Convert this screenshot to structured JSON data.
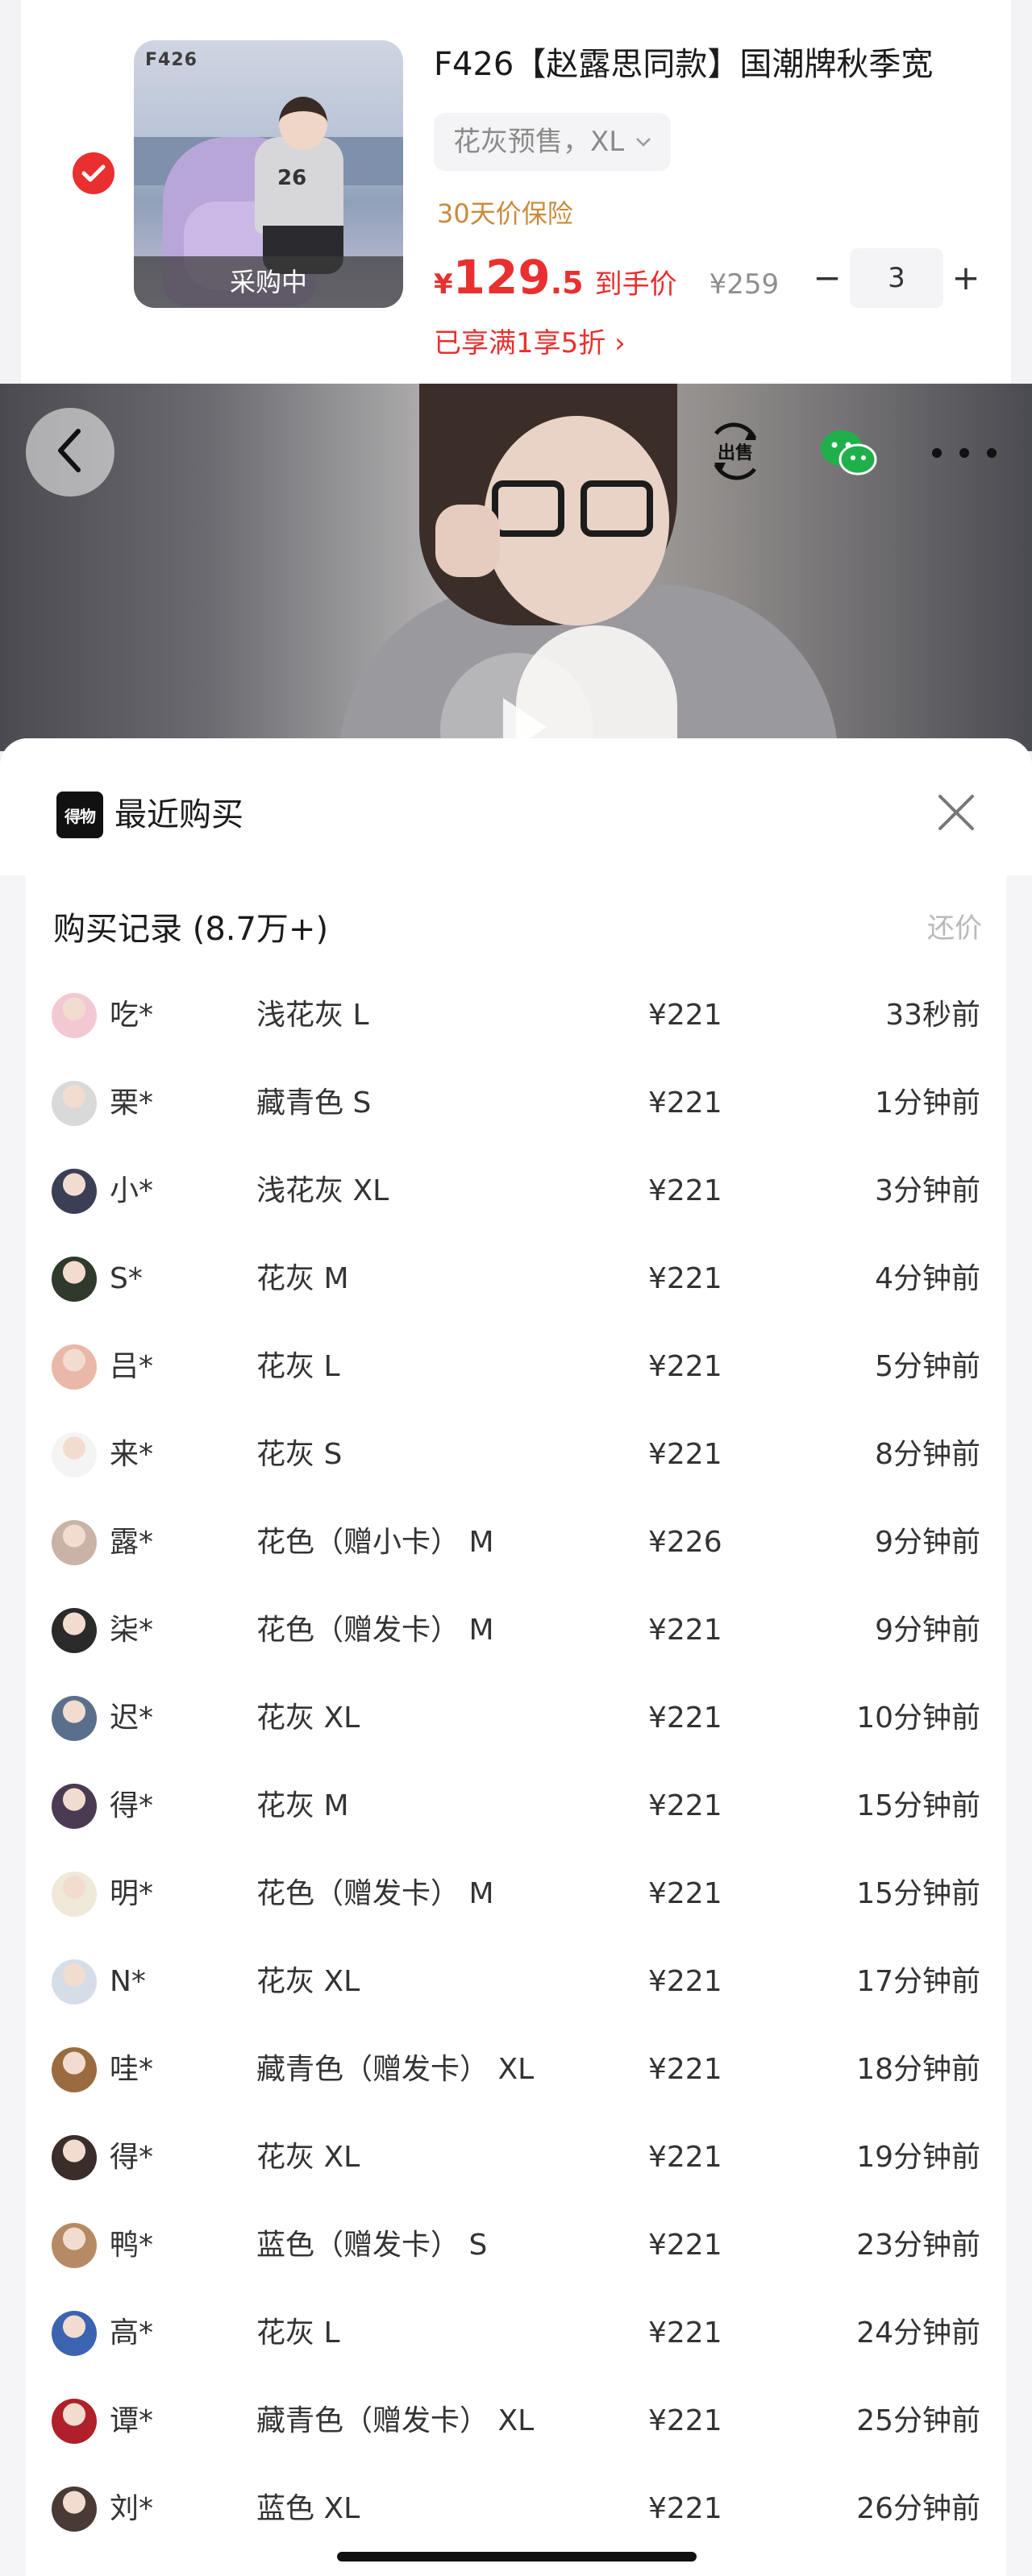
{
  "cart": {
    "thumb_brand": "F426",
    "thumb_number": "26",
    "thumb_overlay": "采购中",
    "title": "F426【赵露思同款】国潮牌秋季宽",
    "spec": "花灰预售，XL",
    "insurance": "30天价保险",
    "price_currency": "¥",
    "price_int": "129",
    "price_dec": ".5",
    "price_arrive": "到手价",
    "original_price": "¥259",
    "quantity": "3",
    "minus": "−",
    "plus": "+",
    "promo": "已享满1享5折 ›"
  },
  "video": {
    "sell_label": "出售"
  },
  "sheet": {
    "logo_text": "得物",
    "title": "最近购买",
    "records_title": "购买记录 (8.7万+)",
    "bargain": "还价",
    "rows": [
      {
        "user": "吃*",
        "spec": "浅花灰 L",
        "price": "¥221",
        "time": "33秒前",
        "avatar_color": "#f2c9d2"
      },
      {
        "user": "栗*",
        "spec": "藏青色 S",
        "price": "¥221",
        "time": "1分钟前",
        "avatar_color": "#d9d9d9"
      },
      {
        "user": "小*",
        "spec": "浅花灰 XL",
        "price": "¥221",
        "time": "3分钟前",
        "avatar_color": "#3a3f55"
      },
      {
        "user": "S*",
        "spec": "花灰 M",
        "price": "¥221",
        "time": "4分钟前",
        "avatar_color": "#2f3a2c"
      },
      {
        "user": "吕*",
        "spec": "花灰 L",
        "price": "¥221",
        "time": "5分钟前",
        "avatar_color": "#e9b8a8"
      },
      {
        "user": "来*",
        "spec": "花灰 S",
        "price": "¥221",
        "time": "8分钟前",
        "avatar_color": "#f4f4f4"
      },
      {
        "user": "露*",
        "spec": "花色（赠小卡） M",
        "price": "¥226",
        "time": "9分钟前",
        "avatar_color": "#c9b3a6"
      },
      {
        "user": "柒*",
        "spec": "花色（赠发卡） M",
        "price": "¥221",
        "time": "9分钟前",
        "avatar_color": "#2a2a2a"
      },
      {
        "user": "迟*",
        "spec": "花灰 XL",
        "price": "¥221",
        "time": "10分钟前",
        "avatar_color": "#5a6f8c"
      },
      {
        "user": "得*",
        "spec": "花灰 M",
        "price": "¥221",
        "time": "15分钟前",
        "avatar_color": "#4a3b52"
      },
      {
        "user": "明*",
        "spec": "花色（赠发卡） M",
        "price": "¥221",
        "time": "15分钟前",
        "avatar_color": "#efe9da"
      },
      {
        "user": "N*",
        "spec": "花灰 XL",
        "price": "¥221",
        "time": "17分钟前",
        "avatar_color": "#d5dee8"
      },
      {
        "user": "哇*",
        "spec": "藏青色（赠发卡） XL",
        "price": "¥221",
        "time": "18分钟前",
        "avatar_color": "#9a6b3f"
      },
      {
        "user": "得*",
        "spec": "花灰 XL",
        "price": "¥221",
        "time": "19分钟前",
        "avatar_color": "#3a2d2a"
      },
      {
        "user": "鸭*",
        "spec": "蓝色（赠发卡） S",
        "price": "¥221",
        "time": "23分钟前",
        "avatar_color": "#b58a64"
      },
      {
        "user": "高*",
        "spec": "花灰 L",
        "price": "¥221",
        "time": "24分钟前",
        "avatar_color": "#3b63b0"
      },
      {
        "user": "谭*",
        "spec": "藏青色（赠发卡） XL",
        "price": "¥221",
        "time": "25分钟前",
        "avatar_color": "#b0202a"
      },
      {
        "user": "刘*",
        "spec": "蓝色 XL",
        "price": "¥221",
        "time": "26分钟前",
        "avatar_color": "#4a3a36"
      }
    ]
  },
  "colors": {
    "accent_red": "#ea2f2f",
    "insurance_gold": "#c98a3c",
    "muted_gray": "#8f8f8f"
  },
  "icons": {
    "check": "check-icon",
    "back": "chevron-left-icon",
    "sell": "sell-icon",
    "wechat": "wechat-icon",
    "more": "more-dots-icon",
    "close": "close-icon",
    "play": "play-icon"
  }
}
